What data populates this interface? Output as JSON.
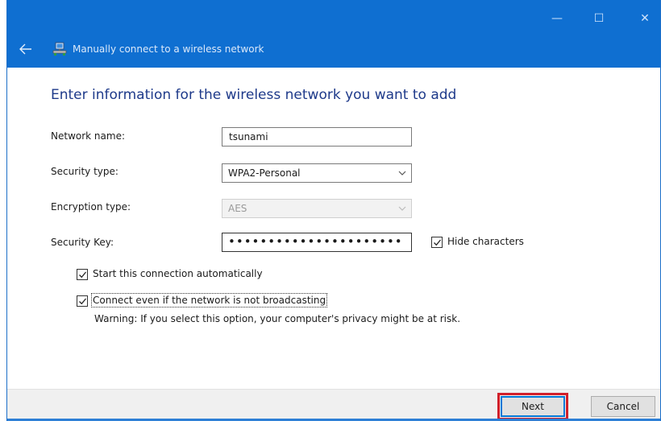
{
  "window": {
    "title": "Manually connect to a wireless network",
    "caption_min": "—",
    "caption_max": "☐",
    "caption_close": "✕"
  },
  "heading": "Enter information for the wireless network you want to add",
  "form": {
    "network_name_label": "Network name:",
    "network_name_value": "tsunami",
    "security_type_label": "Security type:",
    "security_type_value": "WPA2-Personal",
    "encryption_type_label": "Encryption type:",
    "encryption_type_value": "AES",
    "security_key_label": "Security Key:",
    "security_key_value": "••••••••••••••••••••••",
    "hide_characters_label": "Hide characters",
    "hide_characters_checked": true
  },
  "options": {
    "start_auto_label": "Start this connection automatically",
    "start_auto_checked": true,
    "connect_broadcast_label": "Connect even if the network is not broadcasting",
    "connect_broadcast_checked": true,
    "warning": "Warning: If you select this option, your computer's privacy might be at risk."
  },
  "buttons": {
    "next": "Next",
    "cancel": "Cancel"
  },
  "colors": {
    "titlebar": "#0f6fd1",
    "heading": "#1e3a8a",
    "highlight": "#d01f2a"
  },
  "icons": {
    "back": "back-arrow-icon",
    "network": "network-connection-icon"
  }
}
